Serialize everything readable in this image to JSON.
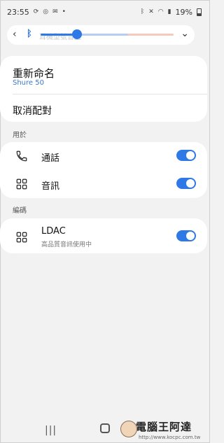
{
  "status_bar": {
    "time": "23:55",
    "battery_percent": "19%",
    "left_icons": [
      "sync-icon",
      "instagram-icon",
      "mail-icon",
      "dot-icon"
    ],
    "right_icons": [
      "bluetooth-icon",
      "mute-icon",
      "wifi-icon",
      "signal-icon",
      "battery-icon"
    ]
  },
  "volume_card": {
    "underlying_text": "耳機型號音量",
    "level": 0.28
  },
  "rename": {
    "title": "重新命名",
    "device_name": "Shure 50"
  },
  "unpair": {
    "label": "取消配對"
  },
  "use_for": {
    "section_label": "用於",
    "items": [
      {
        "icon": "phone-icon",
        "label": "通話",
        "enabled": true
      },
      {
        "icon": "media-audio-icon",
        "label": "音訊",
        "enabled": true
      }
    ]
  },
  "codec": {
    "section_label": "編碼",
    "item": {
      "icon": "codec-icon",
      "label": "LDAC",
      "subtitle": "高品質音訊使用中",
      "enabled": true
    }
  },
  "watermark": {
    "title": "電腦王阿達",
    "url": "http://www.kocpc.com.tw"
  },
  "colors": {
    "accent": "#2e79e6",
    "background": "#f2f2f2",
    "card": "#ffffff",
    "sub_text": "#3b77c9"
  }
}
